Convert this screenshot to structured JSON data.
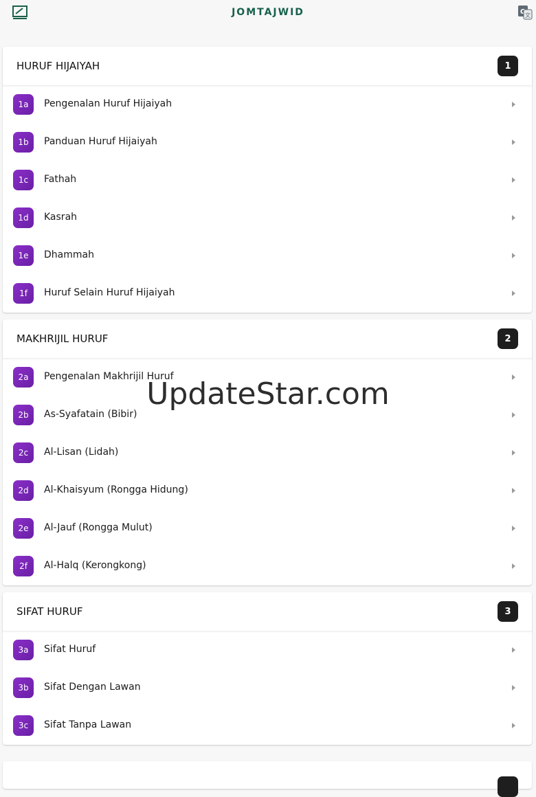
{
  "app": {
    "title": "JOMTAJWID",
    "left_icon": "edit-chart-icon",
    "right_icon": "translate-icon"
  },
  "sections": [
    {
      "title": "HURUF HIJAIYAH",
      "number": "1",
      "items": [
        {
          "code": "1a",
          "label": "Pengenalan Huruf Hijaiyah"
        },
        {
          "code": "1b",
          "label": "Panduan Huruf Hijaiyah"
        },
        {
          "code": "1c",
          "label": "Fathah"
        },
        {
          "code": "1d",
          "label": "Kasrah"
        },
        {
          "code": "1e",
          "label": "Dhammah"
        },
        {
          "code": "1f",
          "label": "Huruf Selain Huruf Hijaiyah"
        }
      ]
    },
    {
      "title": "MAKHRIJIL HURUF",
      "number": "2",
      "items": [
        {
          "code": "2a",
          "label": "Pengenalan Makhrijil Huruf"
        },
        {
          "code": "2b",
          "label": "As-Syafatain (Bibir)"
        },
        {
          "code": "2c",
          "label": "Al-Lisan (Lidah)"
        },
        {
          "code": "2d",
          "label": "Al-Khaisyum (Rongga Hidung)"
        },
        {
          "code": "2e",
          "label": "Al-Jauf (Rongga Mulut)"
        },
        {
          "code": "2f",
          "label": "Al-Halq (Kerongkong)"
        }
      ]
    },
    {
      "title": "SIFAT HURUF",
      "number": "3",
      "items": [
        {
          "code": "3a",
          "label": "Sifat Huruf"
        },
        {
          "code": "3b",
          "label": "Sifat Dengan Lawan"
        },
        {
          "code": "3c",
          "label": "Sifat Tanpa Lawan"
        }
      ]
    }
  ],
  "watermark": "UpdateStar.com",
  "colors": {
    "brand": "#17614a",
    "item_badge": "#7b27b8",
    "section_badge": "#1e1e1e"
  }
}
